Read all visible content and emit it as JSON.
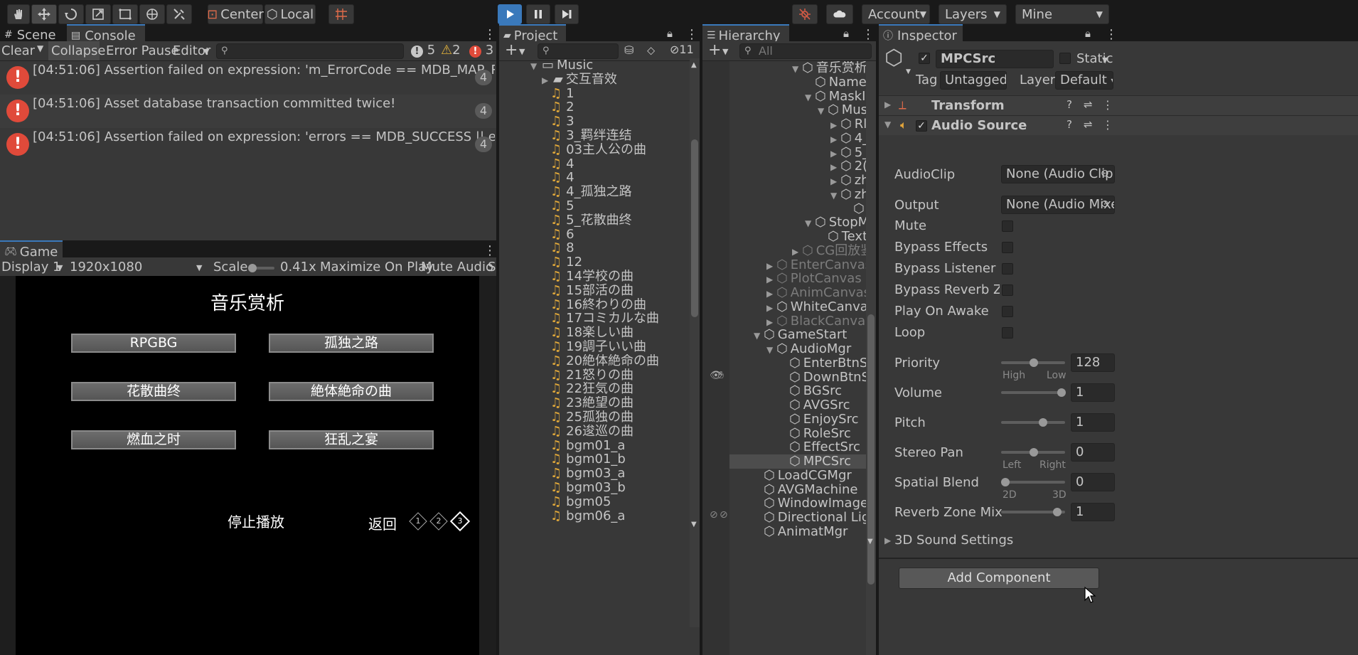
{
  "toolbar": {
    "center_label": "Center",
    "local_label": "Local",
    "account_label": "Account",
    "layers_label": "Layers",
    "layout_label": "Mine"
  },
  "console": {
    "tab_scene": "Scene",
    "tab_console": "Console",
    "clear": "Clear",
    "collapse": "Collapse",
    "error_pause": "Error Pause",
    "editor": "Editor",
    "count_log": "5",
    "count_warn": "2",
    "count_err": "3",
    "messages": [
      {
        "text": "[04:51:06] Assertion failed on expression: 'm_ErrorCode == MDB_MAP_RESIZED || !HasAbort",
        "count": "4"
      },
      {
        "text": "[04:51:06] Asset database transaction committed twice!",
        "count": "4"
      },
      {
        "text": "[04:51:06] Assertion failed on expression: 'errors == MDB_SUCCESS || errors == MDB_NOTF",
        "count": "4"
      }
    ]
  },
  "game": {
    "tab": "Game",
    "display": "Display 1",
    "resolution": "1920x1080",
    "scale_label": "Scale",
    "scale_value": "0.41x",
    "maximize": "Maximize On Play",
    "mute": "Mute Audio",
    "stats_cut": "S",
    "title": "音乐赏析",
    "buttons": [
      "RPGBG",
      "孤独之路",
      "花散曲终",
      "絶体絶命の曲",
      "燃血之时",
      "狂乱之宴"
    ],
    "stop": "停止播放",
    "back": "返回",
    "pages": [
      "1",
      "2",
      "3"
    ]
  },
  "project": {
    "tab": "Project",
    "hidden_count": "11",
    "items": [
      {
        "label": "Music",
        "kind": "folder-open"
      },
      {
        "label": "交互音效",
        "kind": "folder"
      },
      {
        "label": "1",
        "kind": "audio"
      },
      {
        "label": "2",
        "kind": "audio"
      },
      {
        "label": "3",
        "kind": "audio"
      },
      {
        "label": "3_羁绊连结",
        "kind": "audio"
      },
      {
        "label": "03主人公の曲",
        "kind": "audio"
      },
      {
        "label": "4",
        "kind": "audio"
      },
      {
        "label": "4",
        "kind": "audio"
      },
      {
        "label": "4_孤独之路",
        "kind": "audio"
      },
      {
        "label": "5",
        "kind": "audio"
      },
      {
        "label": "5_花散曲终",
        "kind": "audio"
      },
      {
        "label": "6",
        "kind": "audio"
      },
      {
        "label": "8",
        "kind": "audio"
      },
      {
        "label": "12",
        "kind": "audio"
      },
      {
        "label": "14学校の曲",
        "kind": "audio"
      },
      {
        "label": "15部活の曲",
        "kind": "audio"
      },
      {
        "label": "16終わりの曲",
        "kind": "audio"
      },
      {
        "label": "17コミカルな曲",
        "kind": "audio"
      },
      {
        "label": "18楽しい曲",
        "kind": "audio"
      },
      {
        "label": "19調子いい曲",
        "kind": "audio"
      },
      {
        "label": "20絶体絶命の曲",
        "kind": "audio"
      },
      {
        "label": "21怒りの曲",
        "kind": "audio"
      },
      {
        "label": "22狂気の曲",
        "kind": "audio"
      },
      {
        "label": "23絶望の曲",
        "kind": "audio"
      },
      {
        "label": "25孤独の曲",
        "kind": "audio"
      },
      {
        "label": "26逡巡の曲",
        "kind": "audio"
      },
      {
        "label": "bgm01_a",
        "kind": "audio"
      },
      {
        "label": "bgm01_b",
        "kind": "audio"
      },
      {
        "label": "bgm03_a",
        "kind": "audio"
      },
      {
        "label": "bgm03_b",
        "kind": "audio"
      },
      {
        "label": "bgm05",
        "kind": "audio"
      },
      {
        "label": "bgm06_a",
        "kind": "audio"
      }
    ]
  },
  "hierarchy": {
    "tab": "Hierarchy",
    "search_placeholder": "All",
    "items": [
      {
        "label": "音乐赏析",
        "indent": 6,
        "arrow": "down",
        "dim": false
      },
      {
        "label": "Name",
        "indent": 7,
        "arrow": "",
        "dim": false
      },
      {
        "label": "MaskIı",
        "indent": 7,
        "arrow": "down",
        "dim": false
      },
      {
        "label": "Mus",
        "indent": 8,
        "arrow": "down",
        "dim": false
      },
      {
        "label": "Rl",
        "indent": 9,
        "arrow": "right",
        "dim": false
      },
      {
        "label": "4_",
        "indent": 9,
        "arrow": "right",
        "dim": false
      },
      {
        "label": "5_",
        "indent": 9,
        "arrow": "right",
        "dim": false
      },
      {
        "label": "2(",
        "indent": 9,
        "arrow": "right",
        "dim": false
      },
      {
        "label": "zh",
        "indent": 9,
        "arrow": "right",
        "dim": false
      },
      {
        "label": "zh",
        "indent": 9,
        "arrow": "down",
        "dim": false
      },
      {
        "label": "",
        "indent": 10,
        "arrow": "",
        "dim": false
      },
      {
        "label": "StopM",
        "indent": 7,
        "arrow": "down",
        "dim": false
      },
      {
        "label": "Text",
        "indent": 8,
        "arrow": "",
        "dim": false
      },
      {
        "label": "CG回放鉴",
        "indent": 6,
        "arrow": "right",
        "dim": true
      },
      {
        "label": "EnterCanvas",
        "indent": 4,
        "arrow": "right",
        "dim": true
      },
      {
        "label": "PlotCanvas",
        "indent": 4,
        "arrow": "right",
        "dim": true
      },
      {
        "label": "AnimCanvas",
        "indent": 4,
        "arrow": "right",
        "dim": true
      },
      {
        "label": "WhiteCanvas",
        "indent": 4,
        "arrow": "right",
        "dim": false
      },
      {
        "label": "BlackCanvas",
        "indent": 4,
        "arrow": "right",
        "dim": true
      },
      {
        "label": "GameStart",
        "indent": 3,
        "arrow": "down",
        "dim": false
      },
      {
        "label": "AudioMgr",
        "indent": 4,
        "arrow": "down",
        "dim": false
      },
      {
        "label": "EnterBtnSrc",
        "indent": 5,
        "arrow": "",
        "dim": false
      },
      {
        "label": "DownBtnSrc",
        "indent": 5,
        "arrow": "",
        "dim": false
      },
      {
        "label": "BGSrc",
        "indent": 5,
        "arrow": "",
        "dim": false
      },
      {
        "label": "AVGSrc",
        "indent": 5,
        "arrow": "",
        "dim": false
      },
      {
        "label": "EnjoySrc",
        "indent": 5,
        "arrow": "",
        "dim": false
      },
      {
        "label": "RoleSrc",
        "indent": 5,
        "arrow": "",
        "dim": false
      },
      {
        "label": "EffectSrc",
        "indent": 5,
        "arrow": "",
        "dim": false
      },
      {
        "label": "MPCSrc",
        "indent": 5,
        "arrow": "",
        "dim": false
      },
      {
        "label": "LoadCGMgr",
        "indent": 3,
        "arrow": "",
        "dim": false
      },
      {
        "label": "AVGMachine",
        "indent": 3,
        "arrow": "",
        "dim": false
      },
      {
        "label": "WindowImage",
        "indent": 3,
        "arrow": "",
        "dim": false
      },
      {
        "label": "Directional Light",
        "indent": 3,
        "arrow": "",
        "dim": false
      },
      {
        "label": "AnimatMgr",
        "indent": 3,
        "arrow": "",
        "dim": false
      }
    ]
  },
  "inspector": {
    "tab": "Inspector",
    "object_name": "MPCSrc",
    "static_label": "Static",
    "tag_label": "Tag",
    "tag_value": "Untagged",
    "layer_label": "Layer",
    "layer_value": "Default",
    "transform": "Transform",
    "audio_source": "Audio Source",
    "audioclip_label": "AudioClip",
    "audioclip_value": "None (Audio Clip)",
    "output_label": "Output",
    "output_value": "None (Audio Mixer",
    "mute": "Mute",
    "bypass_effects": "Bypass Effects",
    "bypass_listener": "Bypass Listener Effe",
    "bypass_reverb": "Bypass Reverb Zone",
    "play_on_awake": "Play On Awake",
    "loop": "Loop",
    "priority_label": "Priority",
    "priority_value": "128",
    "priority_value_fraction": 0.5,
    "priority_high": "High",
    "priority_low": "Low",
    "volume_label": "Volume",
    "volume_value": "1",
    "pitch_label": "Pitch",
    "pitch_value": "1",
    "stereo_label": "Stereo Pan",
    "stereo_value": "0",
    "stereo_left": "Left",
    "stereo_right": "Right",
    "spatial_label": "Spatial Blend",
    "spatial_value": "0",
    "spatial_2d": "2D",
    "spatial_3d": "3D",
    "reverb_label": "Reverb Zone Mix",
    "reverb_value": "1",
    "sound3d": "3D Sound Settings",
    "add_component": "Add Component"
  }
}
